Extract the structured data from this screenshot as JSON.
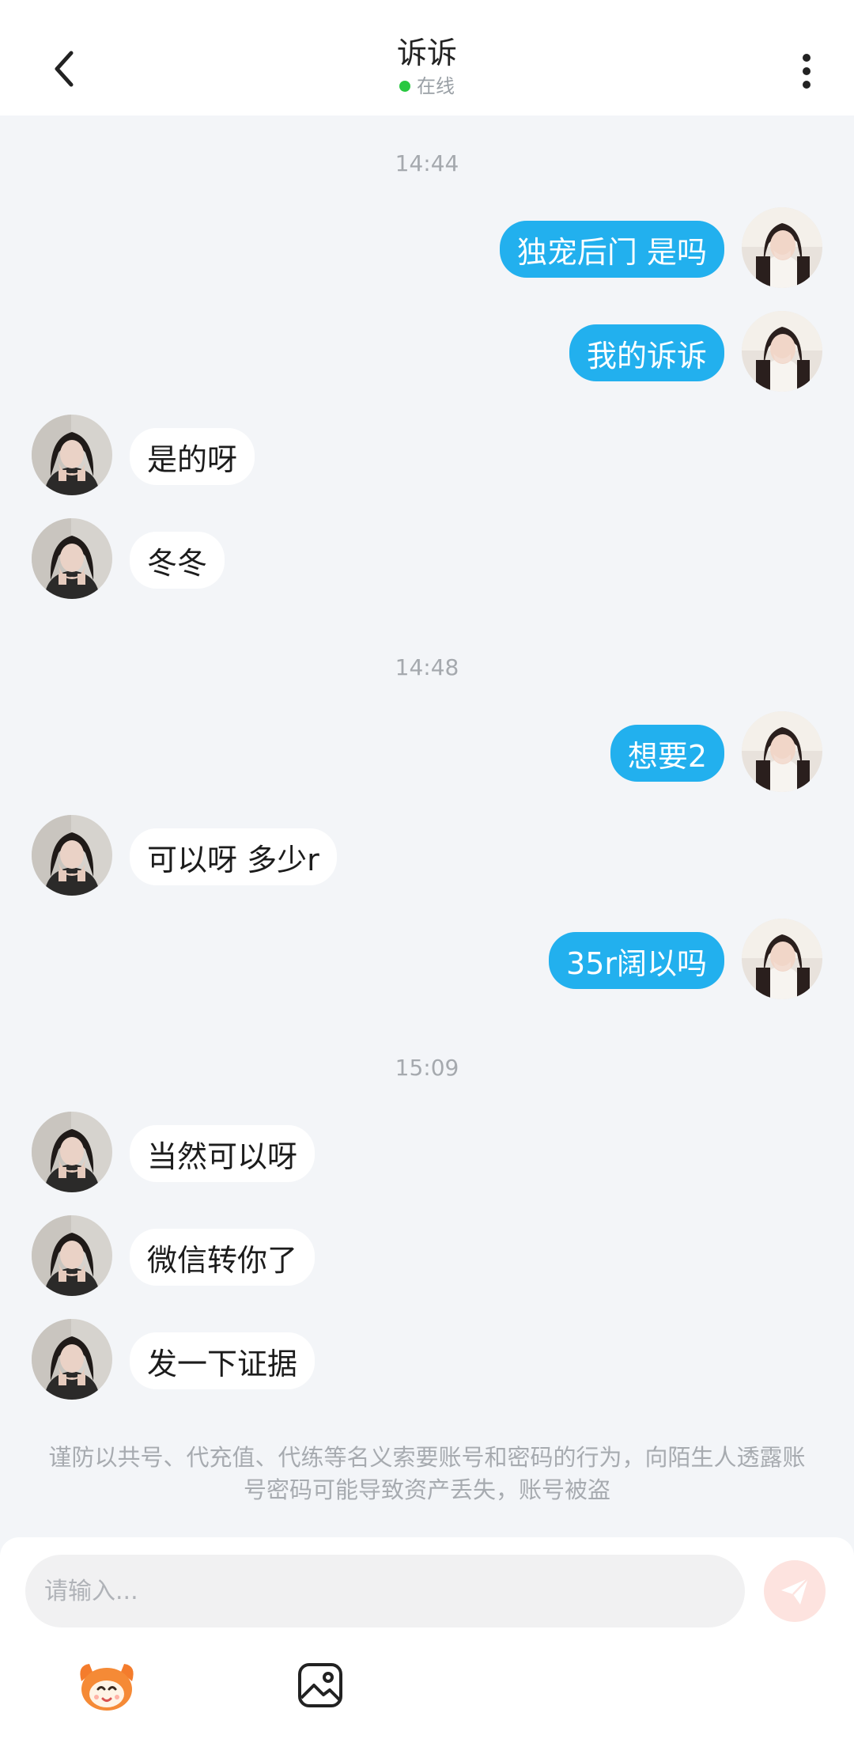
{
  "header": {
    "title": "诉诉",
    "status": "在线",
    "status_color": "#28c840"
  },
  "messages": [
    {
      "kind": "time",
      "text": "14:44"
    },
    {
      "kind": "msg",
      "side": "right",
      "text": "独宠后门 是吗"
    },
    {
      "kind": "msg",
      "side": "right",
      "text": "我的诉诉"
    },
    {
      "kind": "msg",
      "side": "left",
      "text": "是的呀"
    },
    {
      "kind": "msg",
      "side": "left",
      "text": "冬冬"
    },
    {
      "kind": "time",
      "text": "14:48"
    },
    {
      "kind": "msg",
      "side": "right",
      "text": "想要2"
    },
    {
      "kind": "msg",
      "side": "left",
      "text": "可以呀 多少r"
    },
    {
      "kind": "msg",
      "side": "right",
      "text": "35r阔以吗"
    },
    {
      "kind": "time",
      "text": "15:09"
    },
    {
      "kind": "msg",
      "side": "left",
      "text": "当然可以呀"
    },
    {
      "kind": "msg",
      "side": "left",
      "text": "微信转你了"
    },
    {
      "kind": "msg",
      "side": "left",
      "text": "发一下证据"
    }
  ],
  "warning": "谨防以共号、代充值、代练等名义索要账号和密码的行为，向陌生人透露账号密码可能导致资产丢失，账号被盗",
  "composer": {
    "placeholder": "请输入...",
    "send_icon": "send-icon",
    "emoji_icon": "emoji-mascot-icon",
    "image_icon": "image-icon"
  },
  "colors": {
    "outgoing_bubble": "#22b0ee",
    "incoming_bubble": "#ffffff",
    "background": "#f3f5f8",
    "send_button": "#fde3df"
  }
}
